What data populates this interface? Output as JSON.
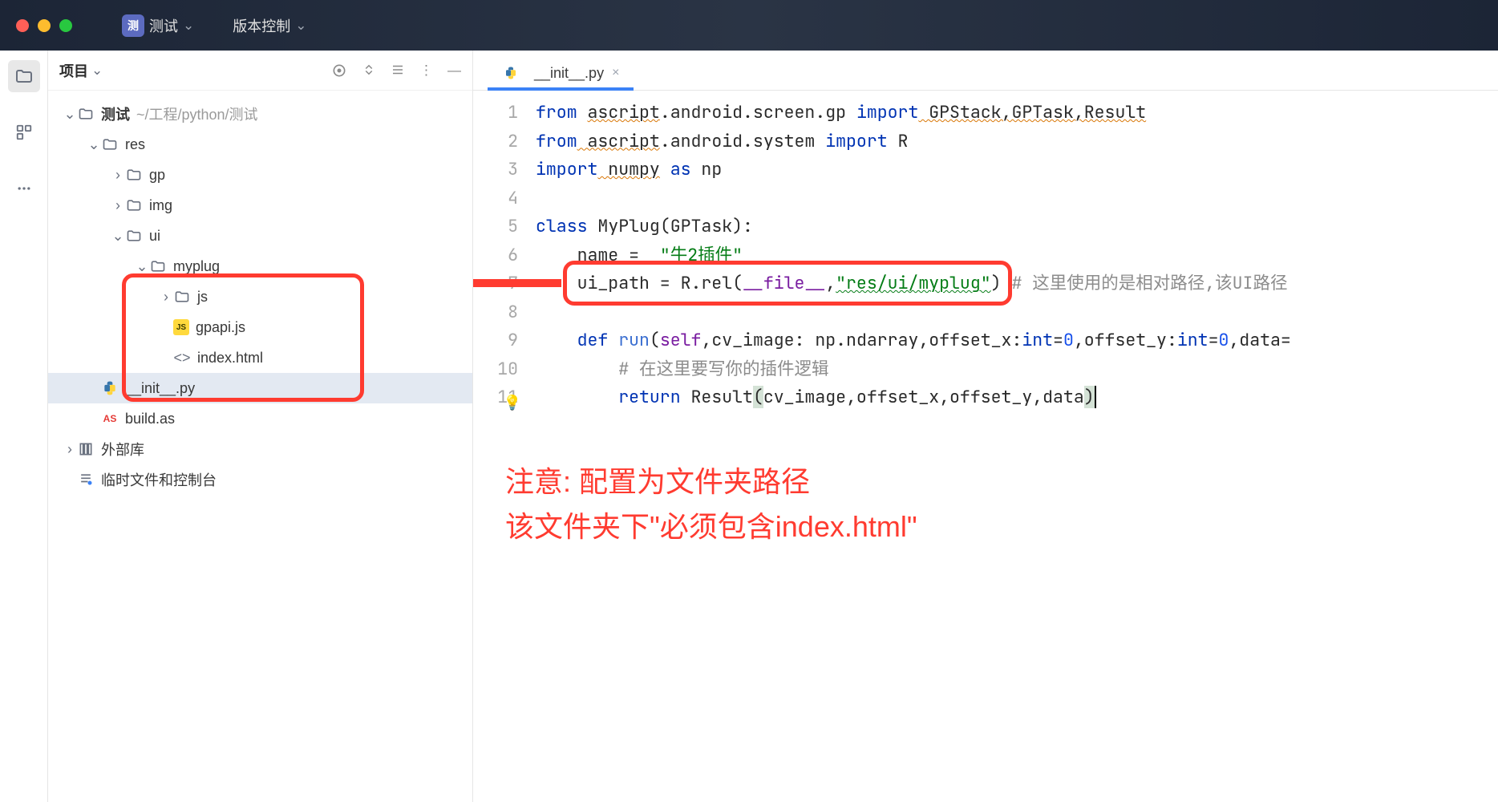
{
  "titlebar": {
    "app_icon_text": "测",
    "app_name": "测试",
    "menu_vcs": "版本控制"
  },
  "project_panel": {
    "title": "项目",
    "tree": {
      "root_name": "测试",
      "root_path": "~/工程/python/测试",
      "res": "res",
      "gp": "gp",
      "img": "img",
      "ui": "ui",
      "myplug": "myplug",
      "js": "js",
      "gpapi": "gpapi.js",
      "index_html": "index.html",
      "init_py": "__init__.py",
      "build_as": "build.as",
      "external_lib": "外部库",
      "scratches": "临时文件和控制台"
    }
  },
  "tabs": {
    "init_py": "__init__.py"
  },
  "code": {
    "lines": [
      "1",
      "2",
      "3",
      "4",
      "5",
      "6",
      "7",
      "8",
      "9",
      "10",
      "11"
    ],
    "l1_from": "from",
    "l1_pkg": "ascript",
    "l1_rest": ".android.screen.gp ",
    "l1_import": "import",
    "l1_names": " GPStack,GPTask,Result",
    "l2_from": "from",
    "l2_pkg": " ascript",
    "l2_rest": ".android.system ",
    "l2_import": "import",
    "l2_r": " R",
    "l3_import": "import",
    "l3_numpy": " numpy",
    "l3_as": " as",
    "l3_np": " np",
    "l5_class": "class",
    "l5_name": " MyPlug(GPTask):",
    "l6_name": "    name =  ",
    "l6_str": "\"牛2插件\"",
    "l7_pre": "    ui_path = R.rel(",
    "l7_file": "__file__",
    "l7_comma": ",",
    "l7_str": "\"res/ui/myplug\"",
    "l7_close": ") ",
    "l7_comment": "# 这里使用的是相对路径,该UI路径",
    "l9_def": "    def",
    "l9_run": " run",
    "l9_sig1": "(",
    "l9_self": "self",
    "l9_sig2": ",cv_image: np.ndarray,offset_x:",
    "l9_int1": "int",
    "l9_eq1": "=",
    "l9_z1": "0",
    "l9_sig3": ",offset_y:",
    "l9_int2": "int",
    "l9_eq2": "=",
    "l9_z2": "0",
    "l9_sig4": ",data=",
    "l10_comment": "        # 在这里要写你的插件逻辑",
    "l11_return": "        return",
    "l11_result": " Result",
    "l11_p1": "(",
    "l11_args": "cv_image,offset_x,offset_y,data",
    "l11_p2": ")"
  },
  "annotation": {
    "line1": "注意: 配置为文件夹路径",
    "line2": "该文件夹下\"必须包含index.html\""
  }
}
